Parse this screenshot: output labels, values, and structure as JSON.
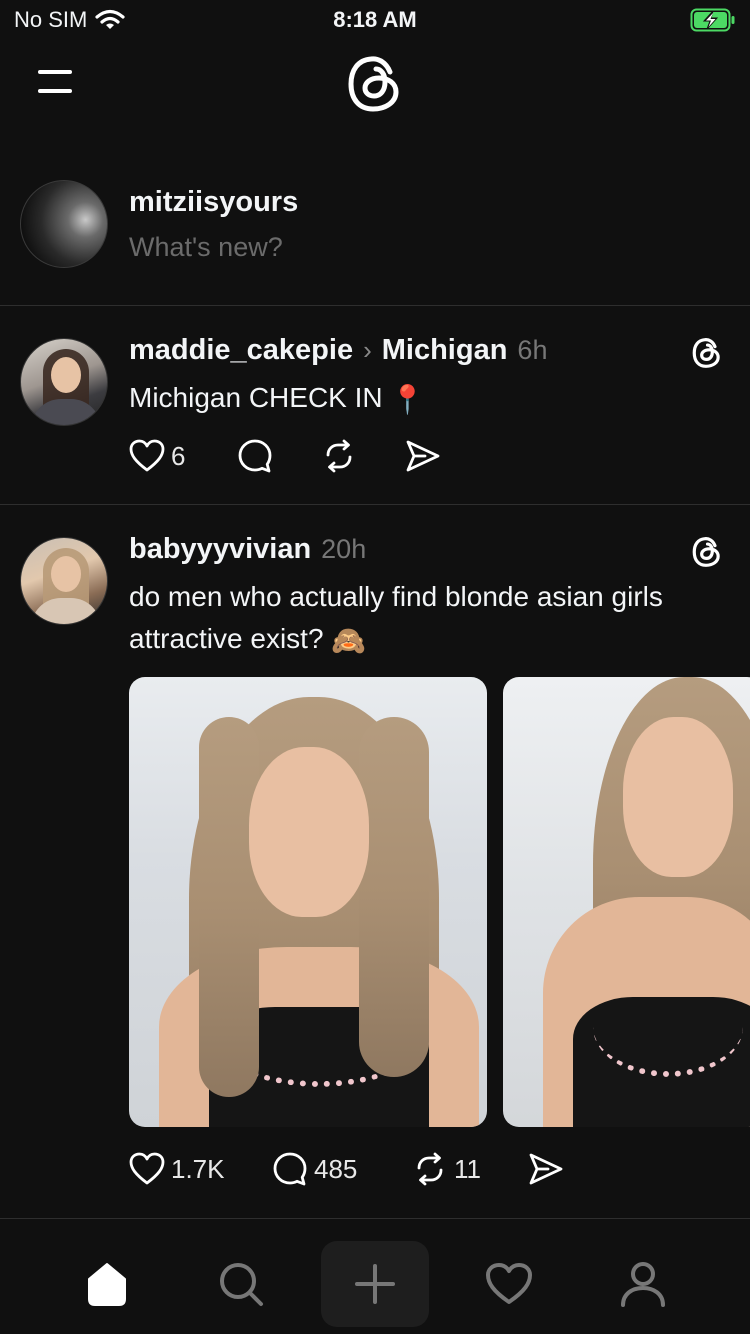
{
  "status_bar": {
    "carrier": "No SIM",
    "time": "8:18 AM",
    "battery_color": "#4cd964"
  },
  "header": {
    "menu_icon": "hamburger-menu-icon",
    "logo_icon": "threads-logo-icon"
  },
  "composer": {
    "username": "mitziisyours",
    "placeholder": "What's new?"
  },
  "posts": [
    {
      "username": "maddie_cakepie",
      "topic": "Michigan",
      "time": "6h",
      "text": "Michigan CHECK IN",
      "text_emoji": "📍",
      "likes": "6",
      "replies": "",
      "reposts": ""
    },
    {
      "username": "babyyyvivian",
      "time": "20h",
      "text": "do men who actually find blonde asian girls attractive exist?",
      "text_emoji": "🙈",
      "likes": "1.7K",
      "replies": "485",
      "reposts": "11"
    }
  ],
  "tab_bar": {
    "items": [
      "home-icon",
      "search-icon",
      "new-thread-icon",
      "activity-heart-icon",
      "profile-icon"
    ],
    "active": "home-icon"
  }
}
